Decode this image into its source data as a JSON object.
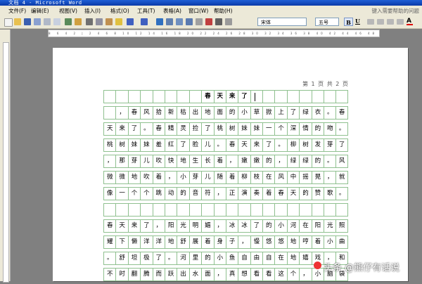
{
  "window": {
    "title": "文档 4 - Microsoft Word"
  },
  "menu": [
    "文件(F)",
    "编辑(E)",
    "视图(V)",
    "插入(I)",
    "格式(O)",
    "工具(T)",
    "表格(A)",
    "窗口(W)",
    "帮助(H)"
  ],
  "help_box": "键入需要帮助的问题",
  "toolbar": {
    "font": "宋体",
    "size": "五号",
    "bold": "B",
    "underline": "U",
    "font_color": "A"
  },
  "ruler_text": "8 6 4 2 | 2 4 6 8 10 12 14 16 18 20 22 24 26 28 30 32 34 36 38 40 42 44 46 48",
  "page_number": "第 1 页 共 2 页",
  "doc": {
    "rows": [
      [
        "",
        "",
        "",
        "",
        "",
        "",
        "",
        "",
        "春",
        "天",
        "来",
        "了",
        "",
        "",
        "",
        "",
        "",
        "",
        "",
        ""
      ],
      [
        "",
        "，",
        "春",
        "风",
        "拾",
        "新",
        "枯",
        "出",
        "地",
        "面",
        "的",
        "小",
        "草",
        "掀",
        "上",
        "了",
        "绿",
        "衣",
        "。",
        "春"
      ],
      [
        "天",
        "来",
        "了",
        "。",
        "春",
        "精",
        "灵",
        "捡",
        "了",
        "桃",
        "树",
        "妹",
        "妹",
        "一",
        "个",
        "深",
        "情",
        "的",
        "吻",
        "。"
      ],
      [
        "桃",
        "树",
        "妹",
        "妹",
        "羞",
        "红",
        "了",
        "脸",
        "儿",
        "。",
        "春",
        "天",
        "来",
        "了",
        "。",
        "柳",
        "树",
        "发",
        "芽",
        "了"
      ],
      [
        "，",
        "那",
        "芽",
        "儿",
        "吹",
        "快",
        "地",
        "生",
        "长",
        "着",
        "，",
        "嫩",
        "嫩",
        "的",
        "，",
        "绿",
        "绿",
        "的",
        "。",
        "风"
      ],
      [
        "微",
        "微",
        "地",
        "吹",
        "着",
        "，",
        "小",
        "芽",
        "儿",
        "随",
        "着",
        "柳",
        "枝",
        "在",
        "风",
        "中",
        "摇",
        "晃",
        "，",
        "就"
      ],
      [
        "像",
        "一",
        "个",
        "个",
        "跳",
        "动",
        "的",
        "音",
        "符",
        "，",
        "正",
        "演",
        "奏",
        "着",
        "春",
        "天",
        "的",
        "赞",
        "歌",
        "。"
      ],
      [
        "",
        "",
        "",
        "",
        "",
        "",
        "",
        "",
        "",
        "",
        "",
        "",
        "",
        "",
        "",
        "",
        "",
        "",
        "",
        ""
      ],
      [
        "春",
        "天",
        "来",
        "了",
        "，",
        "阳",
        "光",
        "明",
        "媚",
        "，",
        "冰",
        "冰",
        "了",
        "的",
        "小",
        "河",
        "在",
        "阳",
        "光",
        "照"
      ],
      [
        "耀",
        "下",
        "懒",
        "洋",
        "洋",
        "地",
        "舒",
        "展",
        "着",
        "身",
        "子",
        "，",
        "慢",
        "悠",
        "悠",
        "地",
        "哼",
        "着",
        "小",
        "曲"
      ],
      [
        "。",
        "舒",
        "坦",
        "极",
        "了",
        "。",
        "河",
        "里",
        "的",
        "小",
        "鱼",
        "自",
        "由",
        "自",
        "在",
        "地",
        "嬉",
        "戏",
        "，",
        "和"
      ],
      [
        "不",
        "时",
        "翻",
        "腾",
        "而",
        "跃",
        "出",
        "水",
        "面",
        "，",
        "真",
        "想",
        "看",
        "看",
        "这",
        "个",
        "，",
        "小",
        "脑",
        "袋"
      ]
    ]
  },
  "watermark": "头条 @熊仔有话说"
}
